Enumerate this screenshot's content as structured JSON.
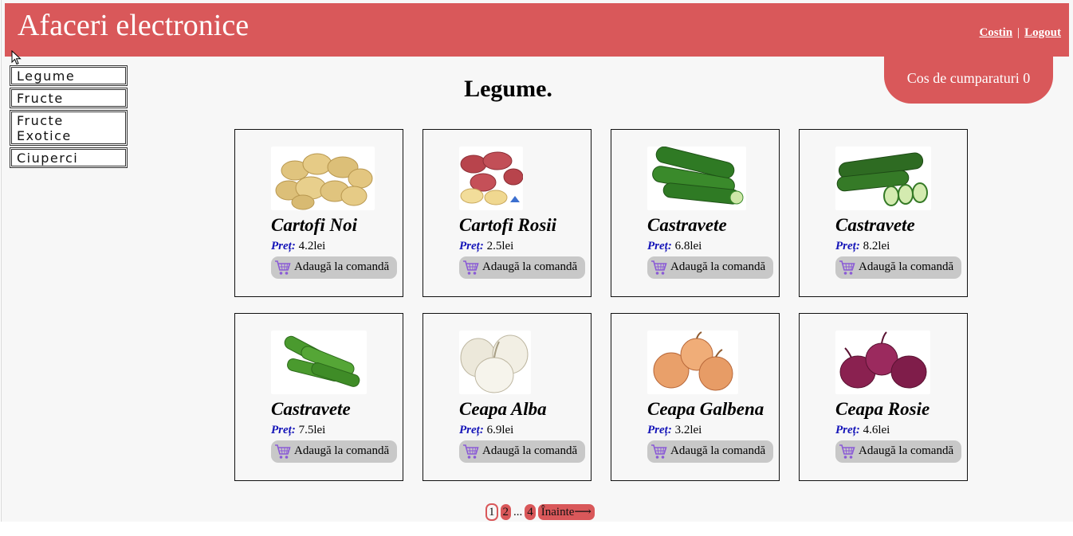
{
  "header": {
    "title": "Afaceri electronice",
    "user": "Costin",
    "separator": "|",
    "logout": "Logout"
  },
  "cart": {
    "label": "Cos de cumparaturi 0"
  },
  "sidebar": {
    "items": [
      {
        "label": "Legume"
      },
      {
        "label": "Fructe\nExotice"
      },
      {
        "label": "Fructe"
      },
      {
        "label": "Ciuperci"
      }
    ],
    "items_ordered": [
      "Legume",
      "Fructe",
      "Fructe Exotice",
      "Ciuperci"
    ]
  },
  "main": {
    "heading": "Legume.",
    "price_label": "Preț:",
    "add_label": "Adaugă la comandă",
    "products": [
      {
        "name": "Cartofi Noi",
        "price": "4.2lei",
        "image": "potatoes"
      },
      {
        "name": "Cartofi Rosii",
        "price": "2.5lei",
        "image": "red-potatoes"
      },
      {
        "name": "Castravete",
        "price": "6.8lei",
        "image": "cucumbers"
      },
      {
        "name": "Castravete",
        "price": "8.2lei",
        "image": "cucumbers-sliced"
      },
      {
        "name": "Castravete",
        "price": "7.5lei",
        "image": "small-cucumbers"
      },
      {
        "name": "Ceapa Alba",
        "price": "6.9lei",
        "image": "white-onions"
      },
      {
        "name": "Ceapa Galbena",
        "price": "3.2lei",
        "image": "yellow-onions"
      },
      {
        "name": "Ceapa Rosie",
        "price": "4.6lei",
        "image": "red-onions"
      }
    ]
  },
  "pagination": {
    "current": "1",
    "page2": "2",
    "dots": "...",
    "last": "4",
    "next": "Înainte⟶"
  },
  "colors": {
    "accent": "#d9585a",
    "price_label": "#1414b8",
    "button_bg": "#c8c8c8",
    "background": "#f7f7f7"
  }
}
